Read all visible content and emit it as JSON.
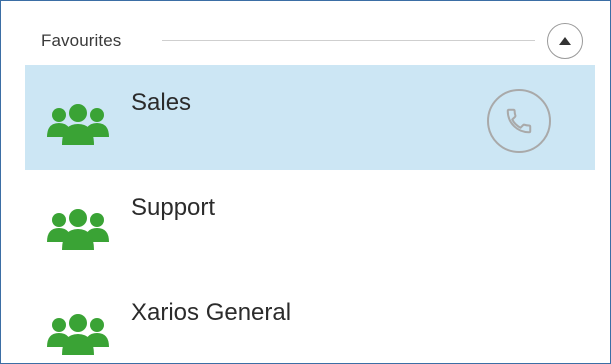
{
  "favourites": {
    "title": "Favourites",
    "collapse_icon": "chevron-up-icon",
    "groups": [
      {
        "name": "Sales",
        "icon": "group-people-icon",
        "selected": true,
        "action_icon": "phone-icon"
      },
      {
        "name": "Support",
        "icon": "group-people-icon",
        "selected": false
      },
      {
        "name": "Xarios General",
        "icon": "group-people-icon",
        "selected": false
      }
    ]
  },
  "colors": {
    "selected_row": "#cce6f4",
    "group_icon": "#3aa335",
    "border": "#3b6ea5"
  }
}
